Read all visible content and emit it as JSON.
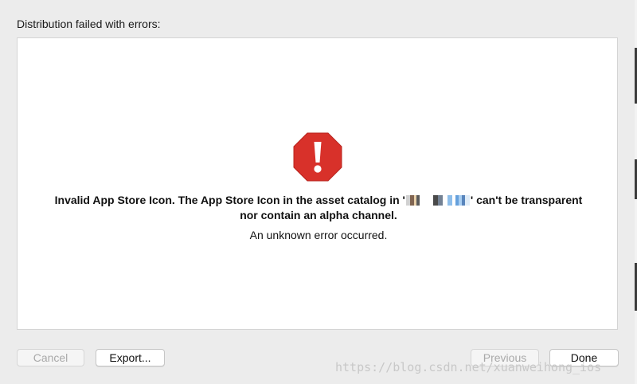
{
  "dialog": {
    "heading": "Distribution failed with errors:",
    "error": {
      "icon": "stop-octagon-exclamation-icon",
      "icon_color": "#d8312a",
      "line1_before": "Invalid App Store Icon. The App Store Icon in the asset catalog in '",
      "line1_after": "' can't be transparent",
      "line2": "nor contain an alpha channel.",
      "detail": "An unknown error occurred."
    }
  },
  "buttons": {
    "cancel": "Cancel",
    "export": "Export...",
    "previous": "Previous",
    "done": "Done"
  },
  "watermark": "https://blog.csdn.net/xuanweihong_ios"
}
